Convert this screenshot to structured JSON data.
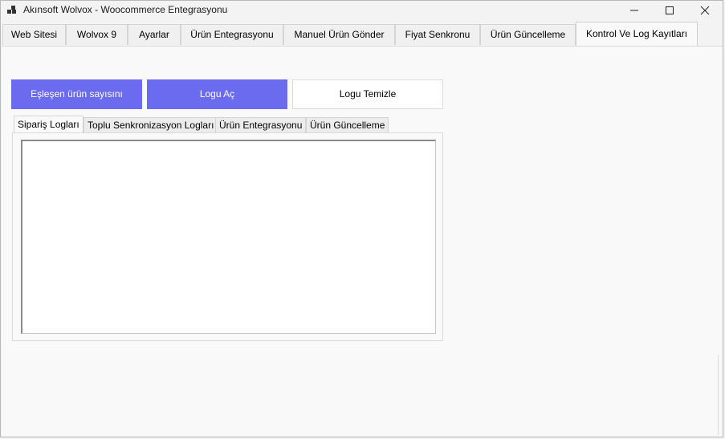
{
  "window": {
    "title": "Akınsoft Wolvox - Woocommerce Entegrasyonu",
    "icon": "app-grid-icon",
    "controls": [
      "minimize-icon",
      "maximize-icon",
      "close-icon"
    ]
  },
  "tabs": [
    {
      "label": "Web Sitesi"
    },
    {
      "label": "Wolvox 9"
    },
    {
      "label": "Ayarlar"
    },
    {
      "label": "Ürün Entegrasyonu"
    },
    {
      "label": "Manuel Ürün Gönder"
    },
    {
      "label": "Fiyat Senkronu"
    },
    {
      "label": "Ürün Güncelleme"
    },
    {
      "label": "Kontrol Ve Log Kayıtları"
    }
  ],
  "active_tab": "Kontrol Ve Log Kayıtları",
  "buttons": {
    "matched_count": "Eşleşen ürün sayısını",
    "open_log": "Logu Aç",
    "clear_log": "Logu Temizle"
  },
  "inner_tabs": [
    {
      "label": "Sipariş Logları"
    },
    {
      "label": "Toplu Senkronizasyon Logları"
    },
    {
      "label": "Ürün Entegrasyonu"
    },
    {
      "label": "Ürün Güncelleme"
    }
  ],
  "active_inner_tab": "Sipariş Logları",
  "log_text": "",
  "colors": {
    "accent_button": "#6b6bf0",
    "window_bg": "#f3f3f3",
    "page_bg": "#f9f9f9"
  }
}
